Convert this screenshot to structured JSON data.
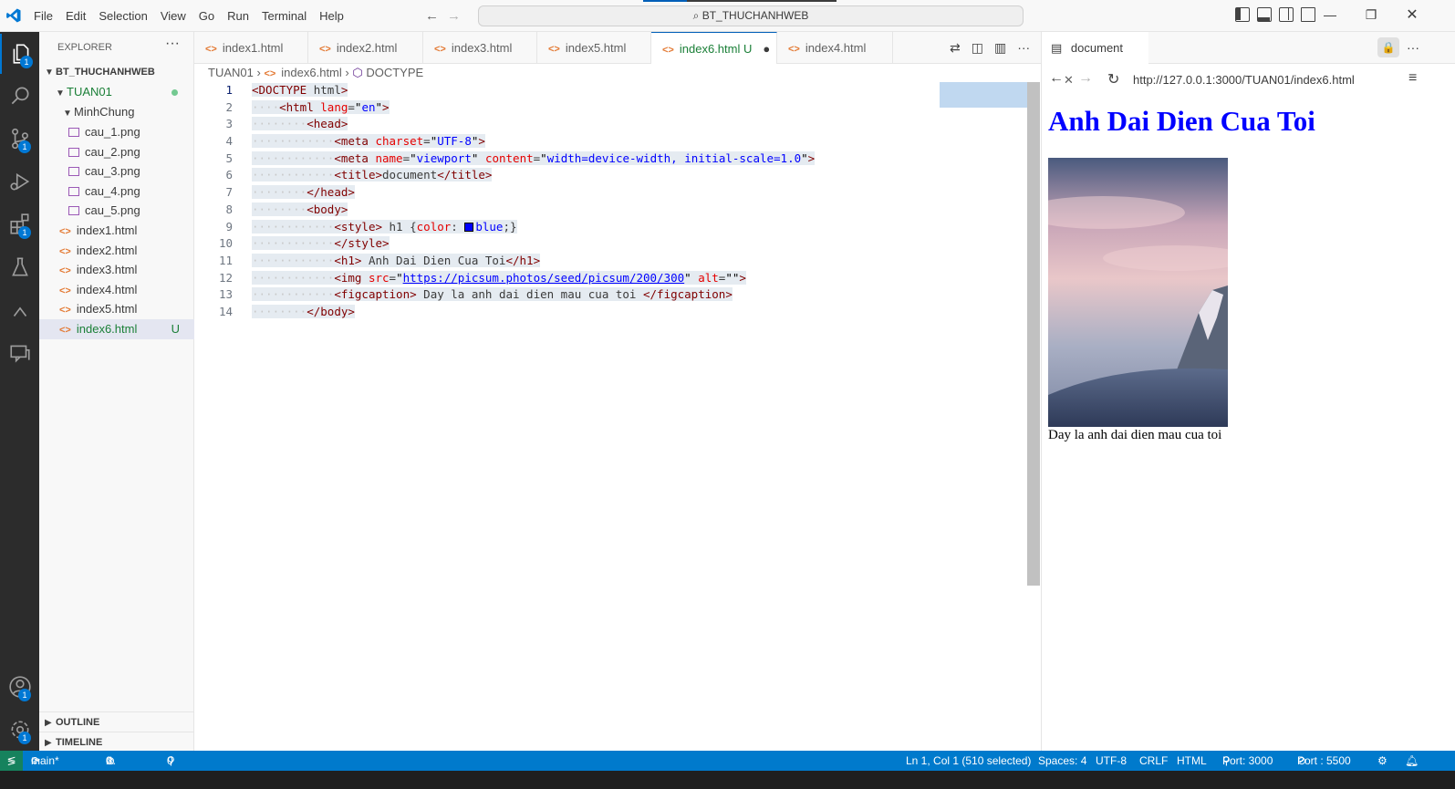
{
  "menu": [
    "File",
    "Edit",
    "Selection",
    "View",
    "Go",
    "Run",
    "Terminal",
    "Help"
  ],
  "search": {
    "label": "BT_THUCHANHWEB"
  },
  "explorer": {
    "title": "EXPLORER",
    "root": "BT_THUCHANHWEB",
    "folder": "TUAN01",
    "subfolder": "MinhChung",
    "images": [
      "cau_1.png",
      "cau_2.png",
      "cau_3.png",
      "cau_4.png",
      "cau_5.png"
    ],
    "files": [
      "index1.html",
      "index2.html",
      "index3.html",
      "index4.html",
      "index5.html",
      "index6.html"
    ],
    "untracked_marker": "U",
    "outline": "OUTLINE",
    "timeline": "TIMELINE"
  },
  "tabs": [
    "index1.html",
    "index2.html",
    "index3.html",
    "index5.html",
    "index6.html",
    "index4.html"
  ],
  "active_tab_marker": "U",
  "breadcrumb": {
    "folder": "TUAN01",
    "file": "index6.html",
    "symbol": "DOCTYPE"
  },
  "code_lines": [
    "<DOCTYPE html>",
    "    <html lang=\"en\">",
    "        <head>",
    "            <meta charset=\"UTF-8\">",
    "            <meta name=\"viewport\" content=\"width=device-width, initial-scale=1.0\">",
    "            <title>document</title>",
    "        </head>",
    "        <body>",
    "            <style> h1 {color: blue;}",
    "            </style>",
    "            <h1> Anh Dai Dien Cua Toi</h1>",
    "            <img src=\"https://picsum.photos/seed/picsum/200/300\" alt=\"\">",
    "            <figcaption> Day la anh dai dien mau cua toi </figcaption>",
    "        </body>"
  ],
  "preview": {
    "tab_title": "document",
    "url": "http://127.0.0.1:3000/TUAN01/index6.html",
    "heading": "Anh Dai Dien Cua Toi",
    "caption": "Day la anh dai dien mau cua toi"
  },
  "badges": {
    "explorer": "1",
    "source_control": "1",
    "extensions": "1",
    "accounts": "1",
    "settings": "1"
  },
  "status": {
    "branch": "main*",
    "errors": "0",
    "warnings": "0",
    "ports": "0",
    "position": "Ln 1, Col 1 (510 selected)",
    "spaces": "Spaces: 4",
    "encoding": "UTF-8",
    "eol": "CRLF",
    "language": "HTML",
    "port": "Port: 3000",
    "live_port": "Port : 5500"
  },
  "colors": {
    "accent": "#007acc",
    "h1": "#0000ff",
    "added": "#1a7f37"
  }
}
